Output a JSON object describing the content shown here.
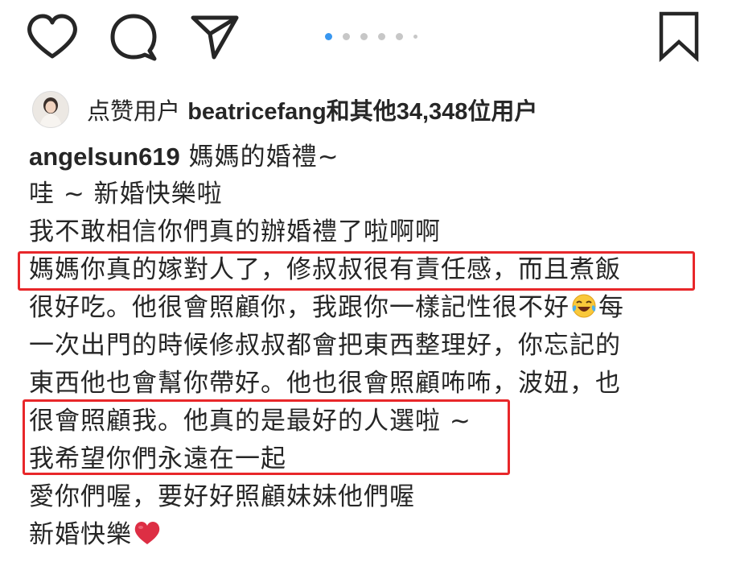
{
  "action_bar": {
    "icons": [
      "heart-icon",
      "comment-icon",
      "share-icon",
      "bookmark-icon"
    ],
    "carousel": {
      "count": 6,
      "active_index": 0
    }
  },
  "likes": {
    "prefix": "点赞用户 ",
    "user": "beatricefang",
    "middle": "和",
    "others": "其他34,348位用户"
  },
  "caption": {
    "username": "angelsun619",
    "first_line_text": " 媽媽的婚禮~",
    "lines": [
      "哇 ~ 新婚快樂啦",
      "我不敢相信你們真的辦婚禮了啦啊啊",
      "媽媽你真的嫁對人了，修叔叔很有責任感，而且煮飯",
      "很好吃。他很會照顧你，我跟你一樣記性很不好",
      "一次出門的時候修叔叔都會把東西整理好，你忘記的",
      "東西他也會幫你帶好。他也很會照顧咘咘，波妞，也",
      "很會照顧我。他真的是最好的人選啦 ~",
      "我希望你們永遠在一起",
      "愛你們喔，要好好照顧妹妹他們喔",
      "新婚快樂"
    ],
    "line4_after_emoji": "每",
    "emojis": {
      "laughing_crying": "face-with-tears-of-joy-icon",
      "heart": "red-heart-icon"
    }
  },
  "highlight_color": "#e8272a",
  "accent_color": "#3897f0"
}
